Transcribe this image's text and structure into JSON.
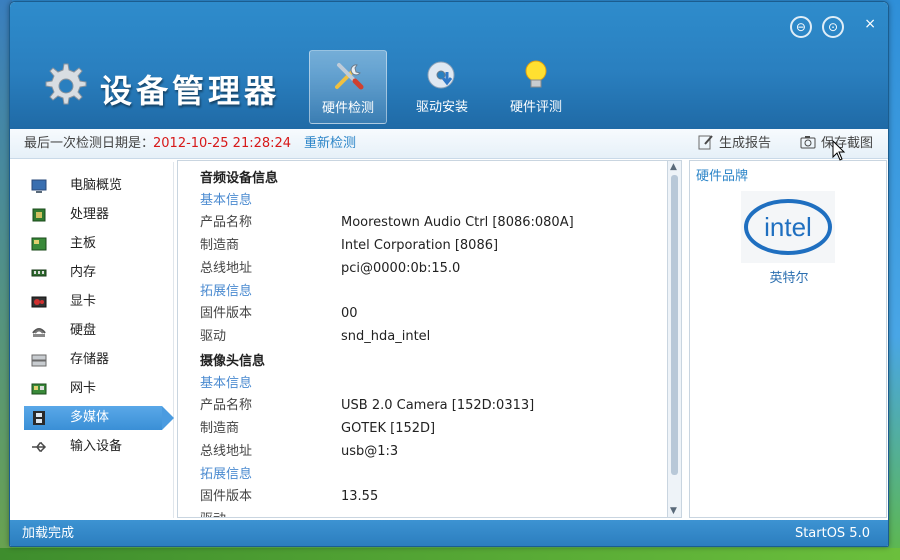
{
  "app": {
    "title": "设备管理器",
    "version": "StartOS 5.0",
    "status": "加载完成"
  },
  "toolbar": {
    "tabs": [
      {
        "label": "硬件检测",
        "icon": "tools-icon",
        "active": true
      },
      {
        "label": "驱动安装",
        "icon": "cd-install-icon",
        "active": false
      },
      {
        "label": "硬件评测",
        "icon": "lightbulb-icon",
        "active": false
      }
    ]
  },
  "window_controls": {
    "minimize": "⊖",
    "restore": "⊙",
    "close": "×"
  },
  "infobar": {
    "last_check_label": "最后一次检测日期是：",
    "last_check_date": "2012-10-25 21:28:24",
    "recheck": "重新检测",
    "report": "生成报告",
    "screenshot": "保存截图"
  },
  "sidebar": {
    "items": [
      {
        "label": "电脑概览",
        "icon": "monitor-icon"
      },
      {
        "label": "处理器",
        "icon": "cpu-icon"
      },
      {
        "label": "主板",
        "icon": "motherboard-icon"
      },
      {
        "label": "内存",
        "icon": "memory-icon"
      },
      {
        "label": "显卡",
        "icon": "graphics-card-icon"
      },
      {
        "label": "硬盘",
        "icon": "hard-disk-icon"
      },
      {
        "label": "存储器",
        "icon": "storage-icon"
      },
      {
        "label": "网卡",
        "icon": "network-card-icon"
      },
      {
        "label": "多媒体",
        "icon": "film-icon",
        "active": true
      },
      {
        "label": "输入设备",
        "icon": "usb-icon"
      }
    ]
  },
  "content": {
    "audio": {
      "title": "音频设备信息",
      "basic": "基本信息",
      "name_k": "产品名称",
      "name_v": "Moorestown Audio Ctrl [8086:080A]",
      "vendor_k": "制造商",
      "vendor_v": "Intel Corporation [8086]",
      "bus_k": "总线地址",
      "bus_v": "pci@0000:0b:15.0",
      "ext": "拓展信息",
      "fw_k": "固件版本",
      "fw_v": "00",
      "drv_k": "驱动",
      "drv_v": "snd_hda_intel"
    },
    "camera": {
      "title": "摄像头信息",
      "basic": "基本信息",
      "name_k": "产品名称",
      "name_v": "USB 2.0 Camera [152D:0313]",
      "vendor_k": "制造商",
      "vendor_v": "GOTEK [152D]",
      "bus_k": "总线地址",
      "bus_v": "usb@1:3",
      "ext": "拓展信息",
      "fw_k": "固件版本",
      "fw_v": "13.55",
      "drv_k": "驱动"
    }
  },
  "brand": {
    "title": "硬件品牌",
    "logo_text": "intel",
    "name": "英特尔"
  }
}
